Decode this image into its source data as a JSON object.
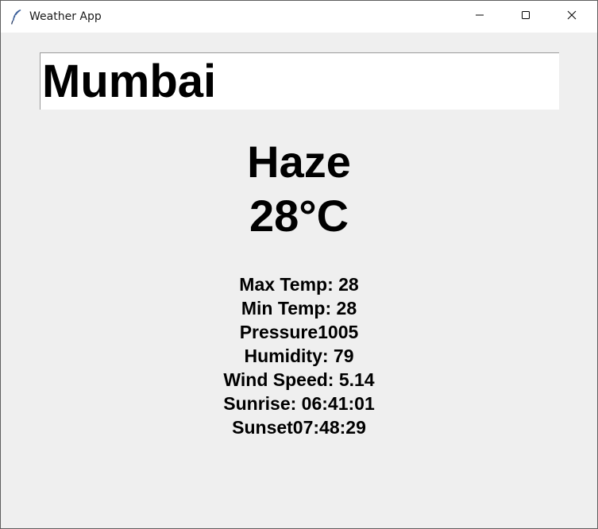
{
  "window": {
    "title": "Weather App",
    "icon": "feather-icon",
    "controls": [
      "minimize-icon",
      "maximize-icon",
      "close-icon"
    ]
  },
  "search": {
    "value": "Mumbai"
  },
  "weather": {
    "condition": "Haze",
    "temperature": "28°C"
  },
  "details": {
    "max_temp": "Max Temp: 28",
    "min_temp": "Min Temp: 28",
    "pressure": "Pressure1005",
    "humidity": "Humidity: 79",
    "wind_speed": "Wind Speed: 5.14",
    "sunrise": "Sunrise: 06:41:01",
    "sunset": "Sunset07:48:29"
  }
}
